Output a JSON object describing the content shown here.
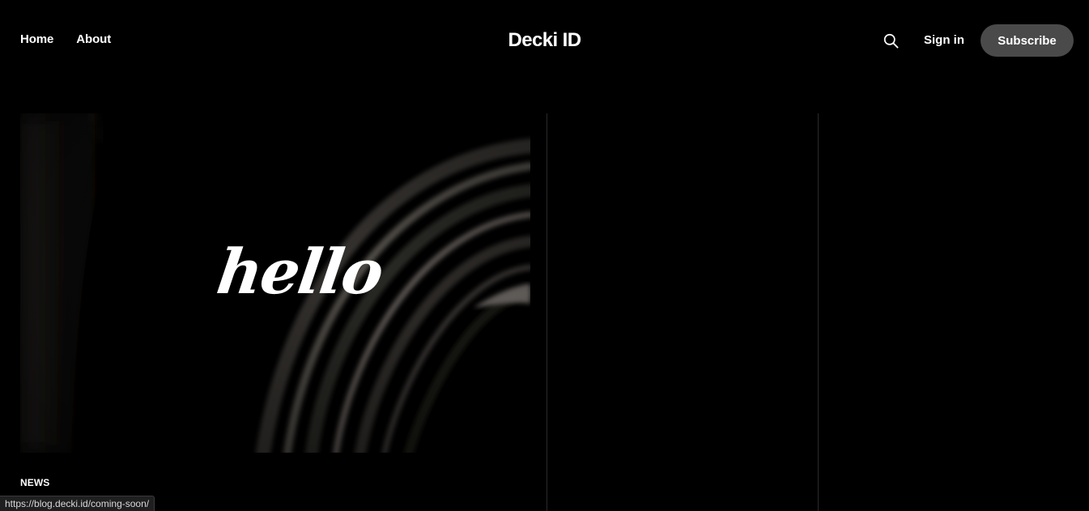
{
  "header": {
    "nav": [
      {
        "label": "Home"
      },
      {
        "label": "About"
      }
    ],
    "brand": "Decki ID",
    "search_icon": "search-icon",
    "signin_label": "Sign in",
    "subscribe_label": "Subscribe"
  },
  "feature": {
    "image_text": "hello",
    "tag": "NEWS"
  },
  "status_bar": {
    "url": "https://blog.decki.id/coming-soon/"
  },
  "colors": {
    "background": "#000000",
    "subscribe_button": "#4a4a4a",
    "divider": "#2a2a2a",
    "text": "#ffffff"
  }
}
